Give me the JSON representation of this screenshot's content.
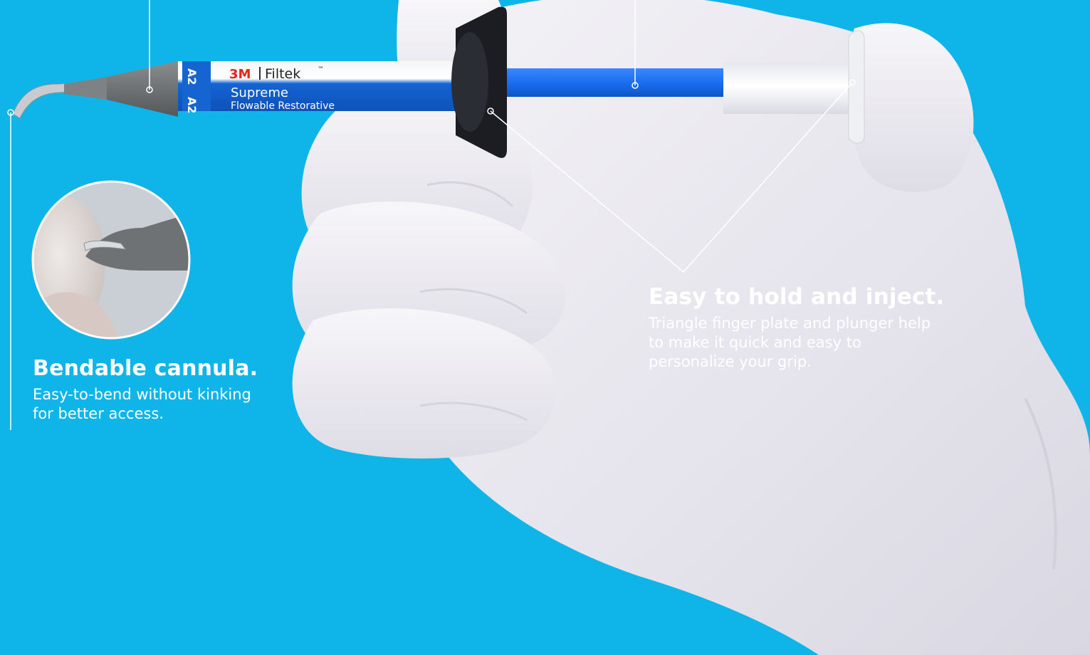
{
  "product_label": {
    "brand": "3M",
    "product": "Filtek",
    "trademark": "™",
    "line": "Supreme",
    "subline": "Flowable Restorative",
    "shade": "A2"
  },
  "callouts": {
    "cannula": {
      "title": "Bendable cannula.",
      "text": "Easy-to-bend without kinking for better access."
    },
    "grip": {
      "title": "Easy to hold and inject.",
      "text": "Triangle finger plate and plunger help to make it quick and easy to personalize your grip."
    }
  },
  "colors": {
    "background": "#0fb4e8",
    "glove": "#ebe9f0",
    "barrel_blue": "#1464d2",
    "plunger_blue": "#1a6ff0",
    "cannula_gray": "#6f7274",
    "brand_red": "#e1261c",
    "callout_text": "#ffffff"
  }
}
